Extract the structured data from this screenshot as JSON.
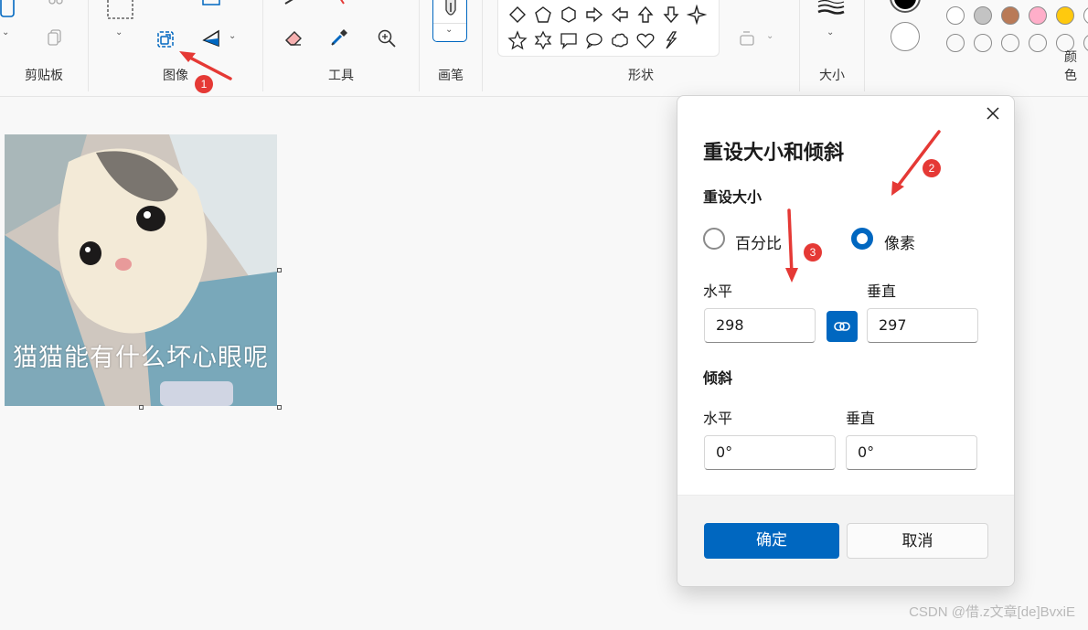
{
  "ribbon": {
    "groups": {
      "clipboard": "剪贴板",
      "image": "图像",
      "tools": "工具",
      "brushes": "画笔",
      "shapes": "形状",
      "size": "大小",
      "colors": "颜色"
    },
    "colors": {
      "primary": "#000000",
      "secondary": "#ffffff",
      "palette_row1": [
        "#ffffff",
        "#c3c3c3",
        "#b97a57",
        "#ffaec9",
        "#ffc90e",
        "#ffffff"
      ],
      "palette_row2": [
        "#ffffff",
        "#ffffff",
        "#ffffff",
        "#ffffff",
        "#ffffff",
        "#ffffff"
      ]
    }
  },
  "canvas": {
    "meme_text": "猫猫能有什么坏心眼呢"
  },
  "dialog": {
    "title": "重设大小和倾斜",
    "resize_section": "重设大小",
    "option_percent": "百分比",
    "option_pixels": "像素",
    "selected_option": "像素",
    "resize_horizontal_label": "水平",
    "resize_vertical_label": "垂直",
    "resize_horizontal_value": "298",
    "resize_vertical_value": "297",
    "skew_section": "倾斜",
    "skew_horizontal_label": "水平",
    "skew_vertical_label": "垂直",
    "skew_horizontal_value": "0°",
    "skew_vertical_value": "0°",
    "ok_label": "确定",
    "cancel_label": "取消"
  },
  "annotations": {
    "badge1": "1",
    "badge2": "2",
    "badge3": "3",
    "arrow_color": "#e53935"
  },
  "watermark": "CSDN @借.z文章[de]BvxiE"
}
